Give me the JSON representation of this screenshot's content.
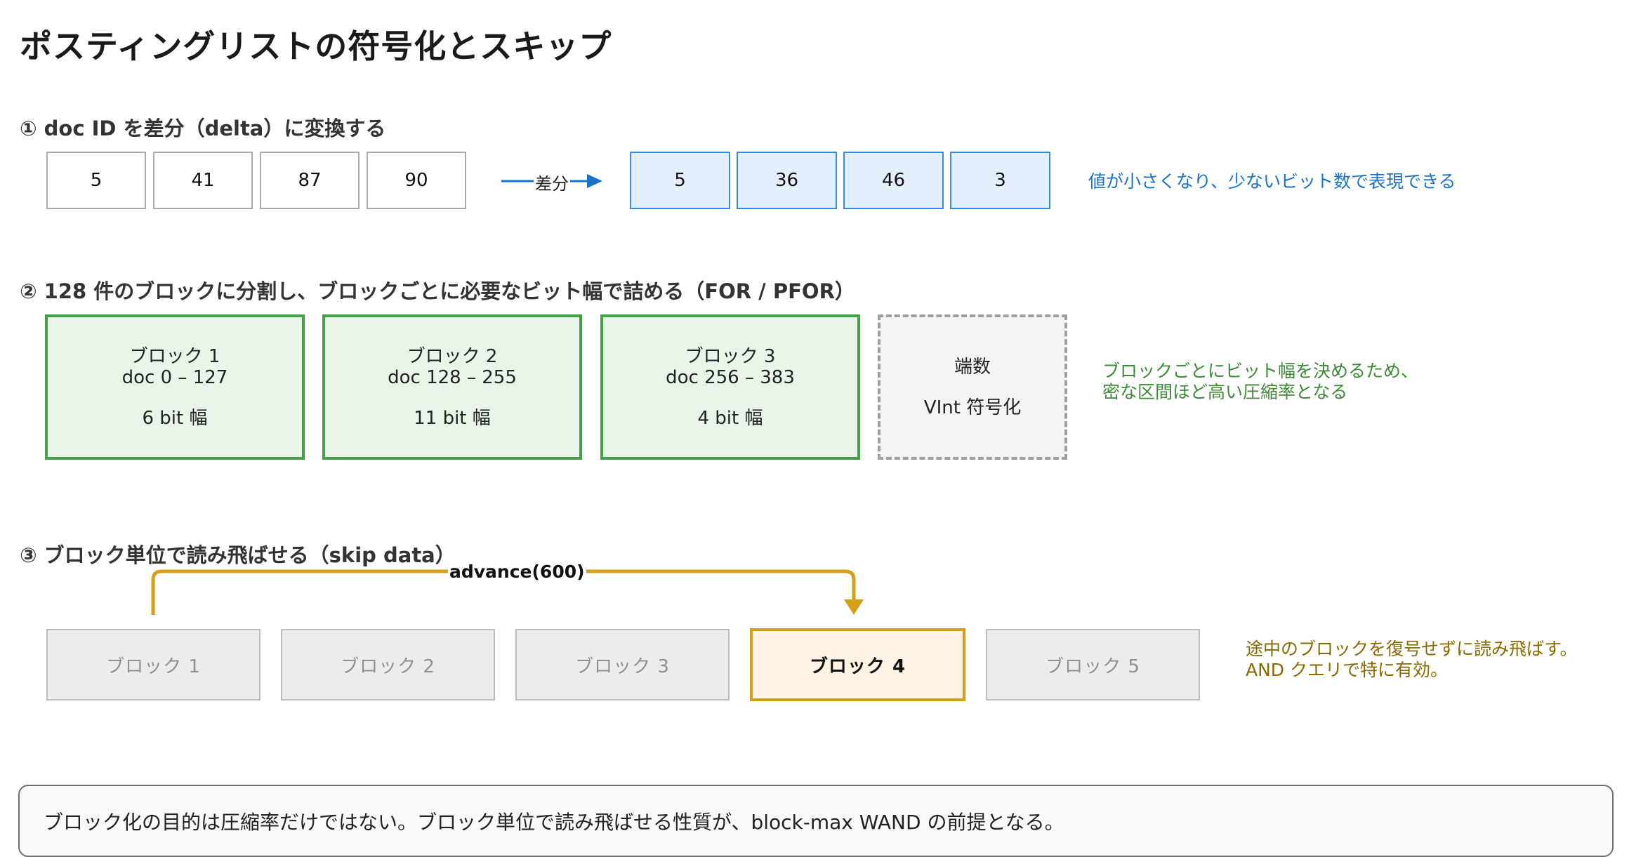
{
  "title": "ポスティングリストの符号化とスキップ",
  "section1": {
    "heading": "① doc ID を差分（delta）に変換する",
    "doc_ids": [
      "5",
      "41",
      "87",
      "90"
    ],
    "arrow_label": "差分",
    "deltas": [
      "5",
      "36",
      "46",
      "3"
    ],
    "note": "値が小さくなり、少ないビット数で表現できる"
  },
  "section2": {
    "heading": "② 128 件のブロックに分割し、ブロックごとに必要なビット幅で詰める（FOR / PFOR）",
    "blocks": [
      {
        "name": "ブロック 1",
        "range": "doc 0 – 127",
        "bits": "6 bit 幅"
      },
      {
        "name": "ブロック 2",
        "range": "doc 128 – 255",
        "bits": "11 bit 幅"
      },
      {
        "name": "ブロック 3",
        "range": "doc 256 – 383",
        "bits": "4 bit 幅"
      }
    ],
    "tail": {
      "name": "端数",
      "encoding": "VInt 符号化"
    },
    "note_line1": "ブロックごとにビット幅を決めるため、",
    "note_line2": "密な区間ほど高い圧縮率となる"
  },
  "section3": {
    "heading": "③ ブロック単位で読み飛ばせる（skip data）",
    "advance_label": "advance(600)",
    "blocks": [
      "ブロック 1",
      "ブロック 2",
      "ブロック 3",
      "ブロック 4",
      "ブロック 5"
    ],
    "active_index": 3,
    "note_line1": "途中のブロックを復号せずに読み飛ばす。",
    "note_line2": "AND クエリで特に有効。"
  },
  "summary": "ブロック化の目的は圧縮率だけではない。ブロック単位で読み飛ばせる性質が、block-max WAND の前提となる。",
  "colors": {
    "delta_border": "#3b8ad6",
    "delta_fill": "#e3f0fb",
    "delta_note": "#1a73c8",
    "block_border": "#45a049",
    "block_fill": "#e8f5e8",
    "block_note": "#3d8b37",
    "skip_accent": "#d4a017",
    "skip_note": "#8a6a00"
  }
}
